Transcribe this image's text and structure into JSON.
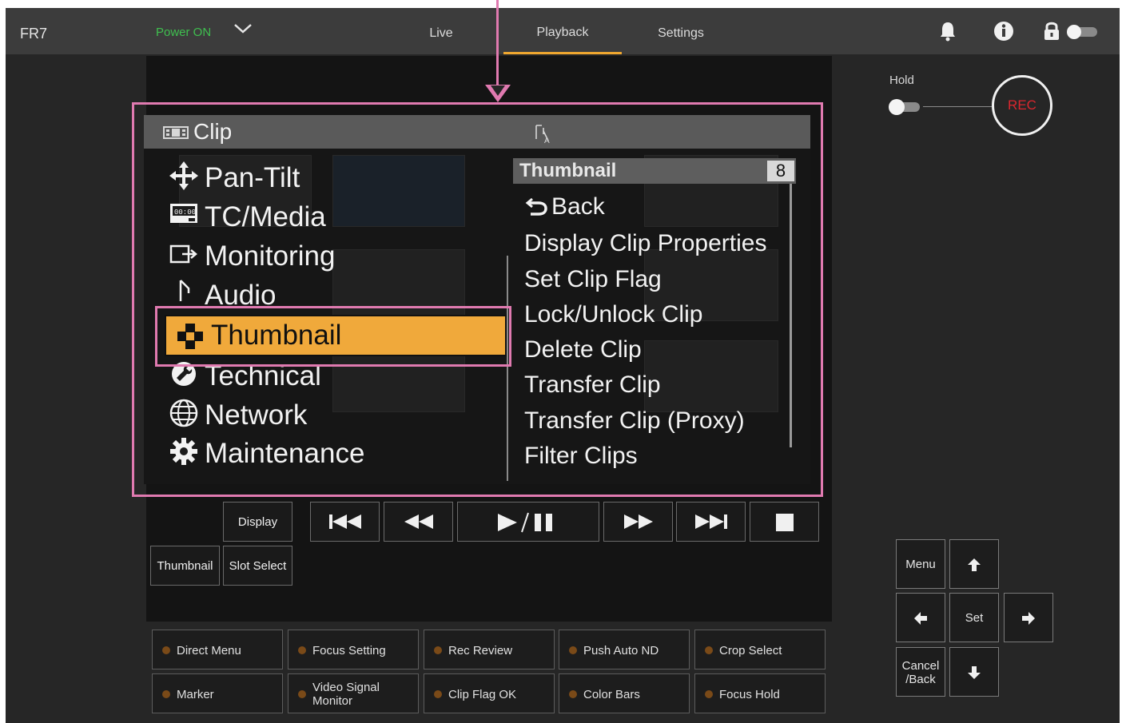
{
  "topbar": {
    "app_name": "FR7",
    "power_label": "Power ON",
    "tabs": [
      {
        "label": "Live"
      },
      {
        "label": "Playback"
      },
      {
        "label": "Settings"
      }
    ]
  },
  "menu": {
    "header_title": "Clip",
    "items": [
      {
        "label": "Pan-Tilt",
        "icon": "pan-tilt-icon"
      },
      {
        "label": "TC/Media",
        "icon": "tc-media-icon"
      },
      {
        "label": "Monitoring",
        "icon": "monitoring-icon"
      },
      {
        "label": "Audio",
        "icon": "audio-icon"
      },
      {
        "label": "Thumbnail",
        "icon": "thumbnail-icon"
      },
      {
        "label": "Technical",
        "icon": "wrench-icon"
      },
      {
        "label": "Network",
        "icon": "globe-icon"
      },
      {
        "label": "Maintenance",
        "icon": "gear-icon"
      }
    ],
    "selected": "Thumbnail",
    "submenu": {
      "title": "Thumbnail",
      "count": "8",
      "items": [
        "Back",
        "Display Clip Properties",
        "Set Clip Flag",
        "Lock/Unlock Clip",
        "Delete Clip",
        "Transfer Clip",
        "Transfer Clip (Proxy)",
        "Filter Clips"
      ]
    }
  },
  "transport": {
    "display_label": "Display",
    "thumbnail_label": "Thumbnail",
    "slot_select_label": "Slot Select"
  },
  "rec": {
    "hold_label": "Hold",
    "rec_label": "REC",
    "accent": "#d9262e"
  },
  "nav": {
    "menu_label": "Menu",
    "set_label": "Set",
    "cancel_label": "Cancel\n/Back"
  },
  "assign_buttons": [
    "Direct Menu",
    "Focus Setting",
    "Rec Review",
    "Push Auto ND",
    "Crop Select",
    "Marker",
    "Video Signal\nMonitor",
    "Clip Flag OK",
    "Color Bars",
    "Focus Hold"
  ],
  "colors": {
    "highlight": "#f0a93b",
    "annotation": "#e07ab0",
    "power_on": "#3fbf4f"
  }
}
